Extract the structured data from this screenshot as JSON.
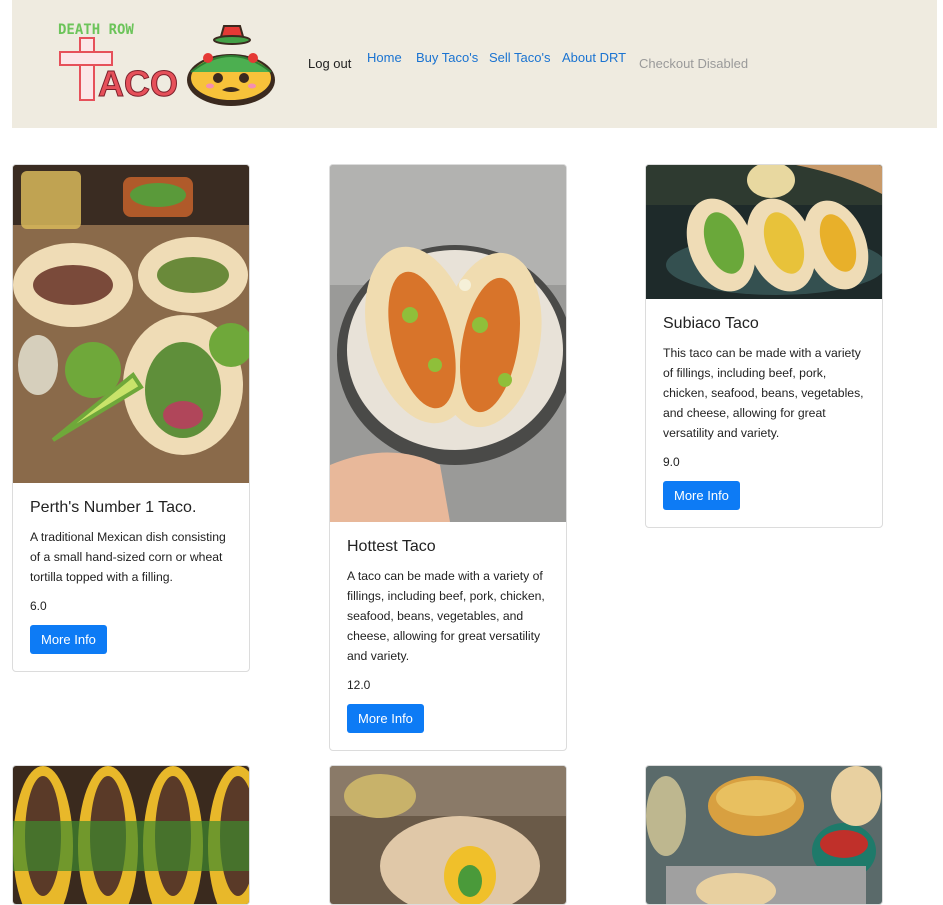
{
  "nav": {
    "logo_top": "DEATH ROW",
    "logo_bottom": "ACO",
    "logout": "Log out",
    "home": "Home",
    "buy": "Buy Taco's",
    "sell": "Sell Taco's",
    "about": "About DRT",
    "checkout": "Checkout Disabled"
  },
  "cards": [
    {
      "title": "Perth's Number 1 Taco.",
      "description": "A traditional Mexican dish consisting of a small hand-sized corn or wheat tortilla topped with a filling.",
      "price": "6.0",
      "button": "More Info"
    },
    {
      "title": "Hottest Taco",
      "description": "A taco can be made with a variety of fillings, including beef, pork, chicken, seafood, beans, vegetables, and cheese, allowing for great versatility and variety.",
      "price": "12.0",
      "button": "More Info"
    },
    {
      "title": "Subiaco Taco",
      "description": "This taco can be made with a variety of fillings, including beef, pork, chicken, seafood, beans, vegetables, and cheese, allowing for great versatility and variety.",
      "price": "9.0",
      "button": "More Info"
    }
  ],
  "colors": {
    "navbar_bg": "#efebe0",
    "link": "#1a73d1",
    "button": "#0d7bf5",
    "logo_red": "#e6505a",
    "logo_green": "#6cc45a"
  }
}
